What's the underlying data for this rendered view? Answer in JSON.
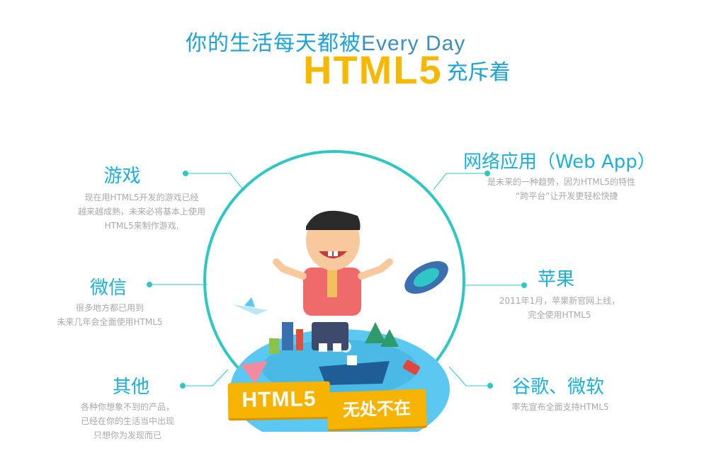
{
  "header": {
    "line1_cn": "你的生活每天都被",
    "line1_en": "Every Day",
    "line2_big": "HTML5",
    "line2_small": "充斥着"
  },
  "features": {
    "games": {
      "title": "游戏",
      "desc": [
        "现在用HTML5开发的游戏已经",
        "越来越成熟，未来必将基本上使用",
        "HTML5来制作游戏,"
      ]
    },
    "wechat": {
      "title": "微信",
      "desc": [
        "很多地方都已用到",
        "未来几年会全面使用HTML5"
      ]
    },
    "others": {
      "title": "其他",
      "desc": [
        "各种你想象不到的产品，",
        "已经在你的生活当中出现",
        "只想你为发现而已"
      ]
    },
    "webapp": {
      "title": "网络应用（Web App）",
      "desc": [
        "是未来的一种趋势，因为HTML5的特性",
        "“跨平台”让开发更轻松快捷"
      ]
    },
    "apple": {
      "title": "苹果",
      "desc": [
        "2011年1月，苹果新官网上线，",
        "完全使用HTML5"
      ]
    },
    "google": {
      "title": "谷歌、微软",
      "desc": [
        "率先宣布全面支持HTML5"
      ]
    }
  },
  "banner": {
    "part1": "HTML5",
    "part2": "无处不在"
  },
  "colors": {
    "accent_blue": "#1cb0d8",
    "accent_teal": "#2ec7c6",
    "accent_yellow": "#f6b800",
    "desc_gray": "#a9a9a9"
  }
}
